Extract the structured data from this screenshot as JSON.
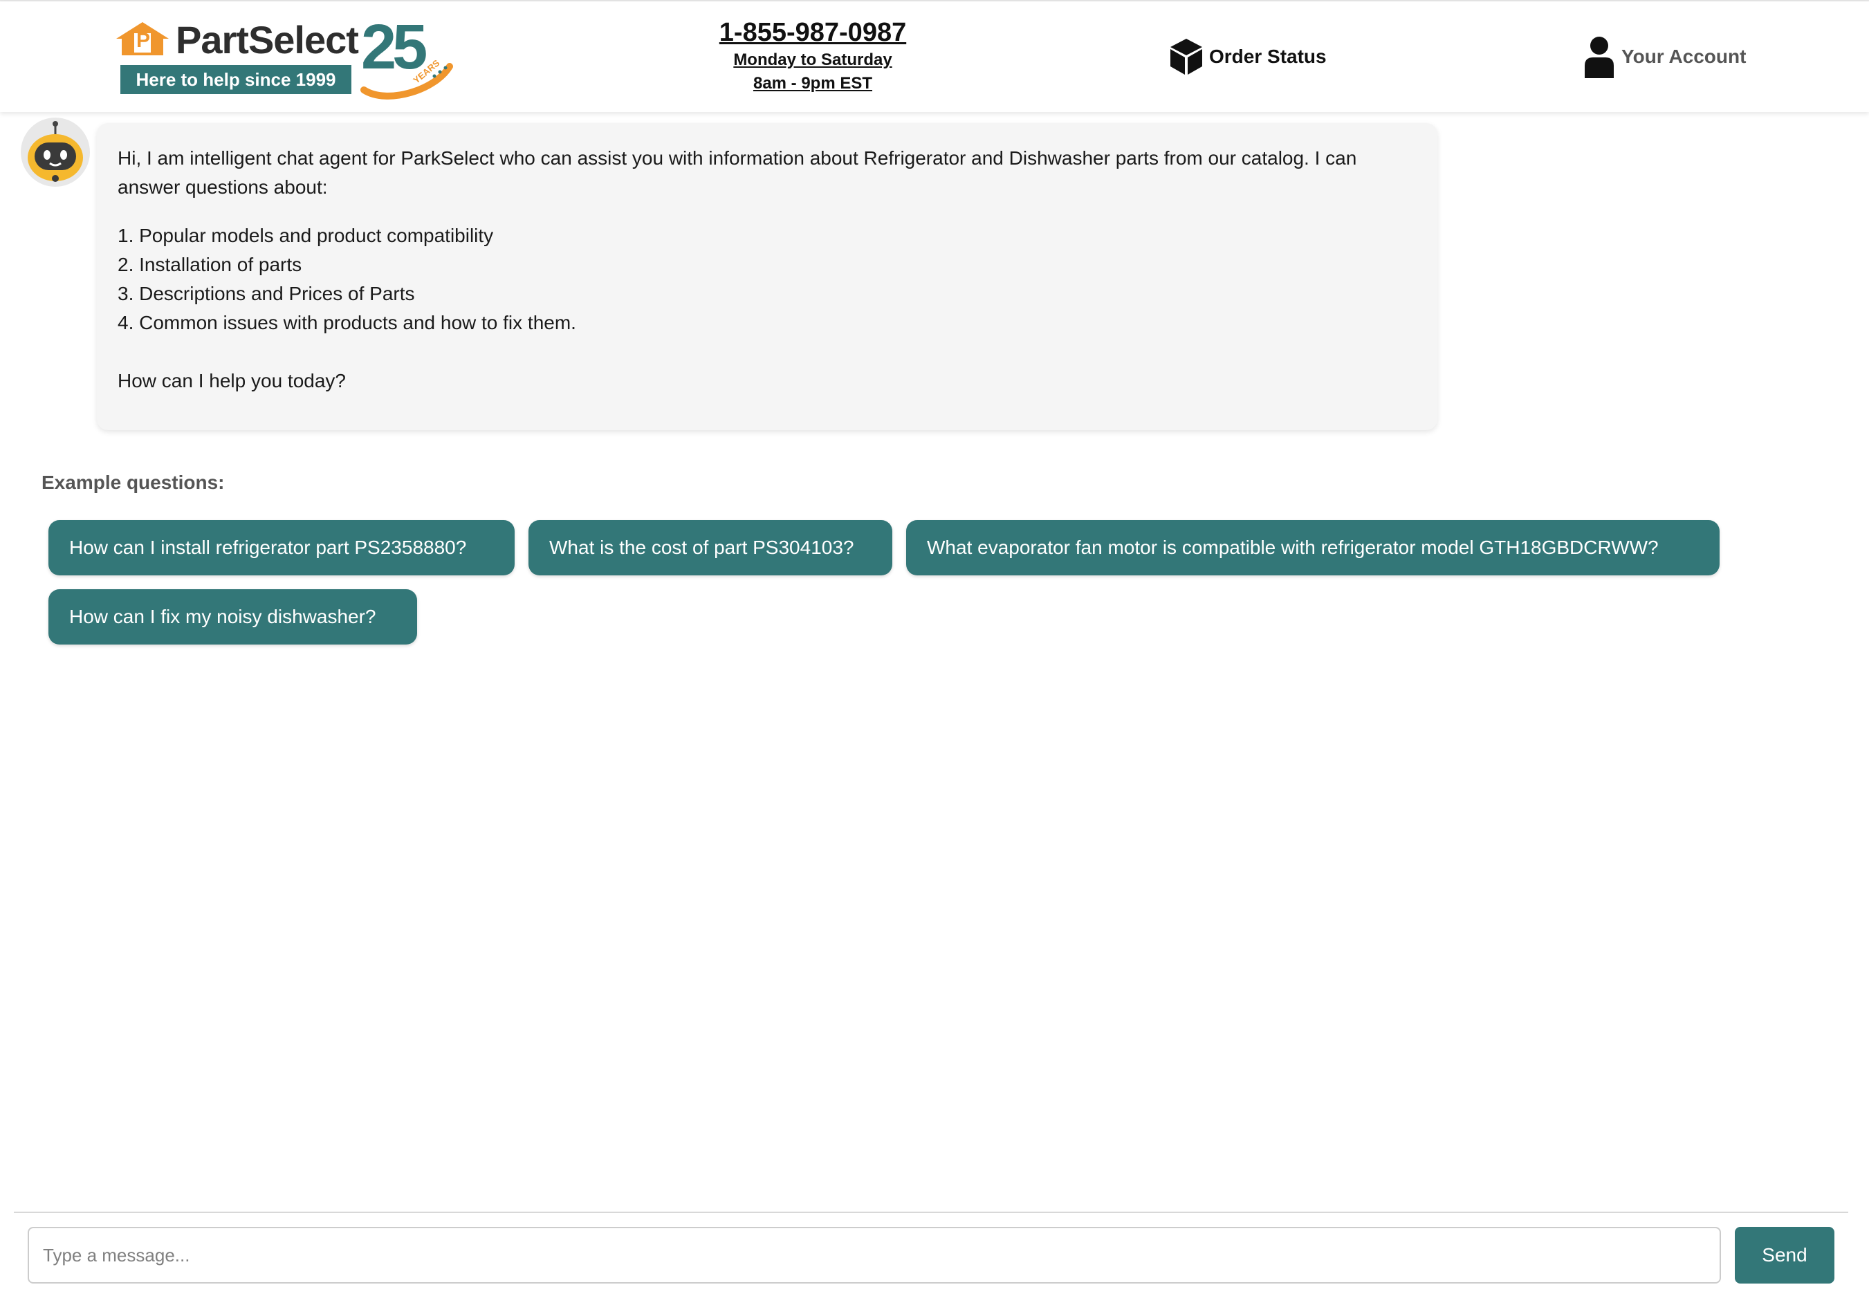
{
  "header": {
    "logo": {
      "wordmark": "PartSelect",
      "tagline": "Here to help since 1999",
      "badge_number": "25",
      "badge_text": "YEARS",
      "house_letter": "P"
    },
    "phone": "1-855-987-0987",
    "hours_days": "Monday to Saturday",
    "hours_time": "8am - 9pm EST",
    "order_status_label": "Order Status",
    "order_status_icon": "box-icon",
    "account_label": "Your Account",
    "account_icon": "user-icon"
  },
  "chat": {
    "bot_avatar_icon": "robot-icon",
    "messages": [
      {
        "role": "bot",
        "intro": "Hi, I am intelligent chat agent for ParkSelect who can assist you with information about Refrigerator and Dishwasher parts from our catalog. I can answer questions about:",
        "items": [
          "1. Popular models and product compatibility",
          "2. Installation of parts",
          "3. Descriptions and Prices of Parts",
          "4. Common issues with products and how to fix them."
        ],
        "outro": "How can I help you today?"
      }
    ]
  },
  "examples": {
    "label": "Example questions:",
    "questions": [
      "How can I install refrigerator part PS2358880?",
      "What is the cost of part PS304103?",
      "What evaporator fan motor is compatible with refrigerator model GTH18GBDCRWW?",
      "How can I fix my noisy dishwasher?"
    ]
  },
  "composer": {
    "placeholder": "Type a message...",
    "send_label": "Send"
  },
  "colors": {
    "brand_teal": "#337778",
    "brand_orange": "#f0962d",
    "bubble_bg": "#f5f5f5"
  }
}
